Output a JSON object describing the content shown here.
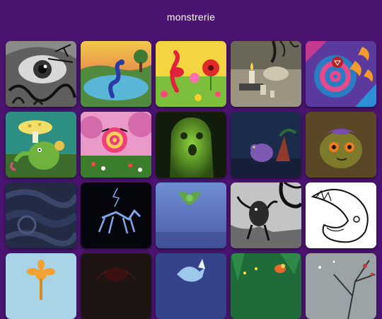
{
  "header": {
    "title": "monstrerie"
  },
  "colors": {
    "background": "#4b1470"
  },
  "gallery": {
    "tiles": [
      {
        "id": "t1",
        "art": "grey-eye-ink-creature"
      },
      {
        "id": "t2",
        "art": "serpent-in-lake-at-sunset"
      },
      {
        "id": "t3",
        "art": "flamingo-flowers"
      },
      {
        "id": "t4",
        "art": "candle-and-hanging-creature"
      },
      {
        "id": "t5",
        "art": "spiral-with-orange-horns"
      },
      {
        "id": "t6",
        "art": "mushroom-creature"
      },
      {
        "id": "t7",
        "art": "spiral-creature-in-pink-forest"
      },
      {
        "id": "t8",
        "art": "green-ghost"
      },
      {
        "id": "t9",
        "art": "purple-creature-dark-blue"
      },
      {
        "id": "t10",
        "art": "olive-creature-orange-eyes"
      },
      {
        "id": "t11",
        "art": "dark-storm-swirls"
      },
      {
        "id": "t12",
        "art": "blue-line-creature-on-black"
      },
      {
        "id": "t13",
        "art": "green-bat-on-blue"
      },
      {
        "id": "t14",
        "art": "ink-tentacle-tree"
      },
      {
        "id": "t15",
        "art": "line-drawing-fish-creature"
      },
      {
        "id": "t16",
        "art": "orange-flower-creature"
      },
      {
        "id": "t17",
        "art": "dark-red-silhouette"
      },
      {
        "id": "t18",
        "art": "blue-creature-partial"
      },
      {
        "id": "t19",
        "art": "green-forest-with-bird"
      },
      {
        "id": "t20",
        "art": "snowy-branches"
      }
    ]
  }
}
